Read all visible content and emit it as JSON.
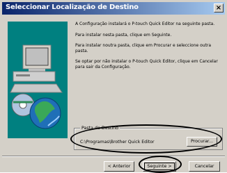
{
  "window": {
    "title": "Seleccionar Localização de Destino",
    "close_glyph": "×"
  },
  "content": {
    "paragraphs": [
      "A Configuração instalará o P-touch Quick Editor na seguinte pasta.",
      "Para instalar nesta pasta, clique em Seguinte.",
      "Para instalar noutra pasta, clique em Procurar e seleccione outra pasta.",
      "Se optar por não instalar o P-touch Quick Editor, clique em Cancelar para sair da Configuração."
    ]
  },
  "destination": {
    "group_label": "Pasta de Destino",
    "path": "C:\\Programas\\Brother Quick Editor",
    "browse_label": "Procurar..."
  },
  "buttons": {
    "back_label": "< Anterior",
    "next_label": "Seguinte >",
    "cancel_label": "Cancelar"
  },
  "colors": {
    "title_start": "#0a246a",
    "title_end": "#a6caf0",
    "dialog_bg": "#d4d0c8",
    "art_bg": "#008080"
  }
}
